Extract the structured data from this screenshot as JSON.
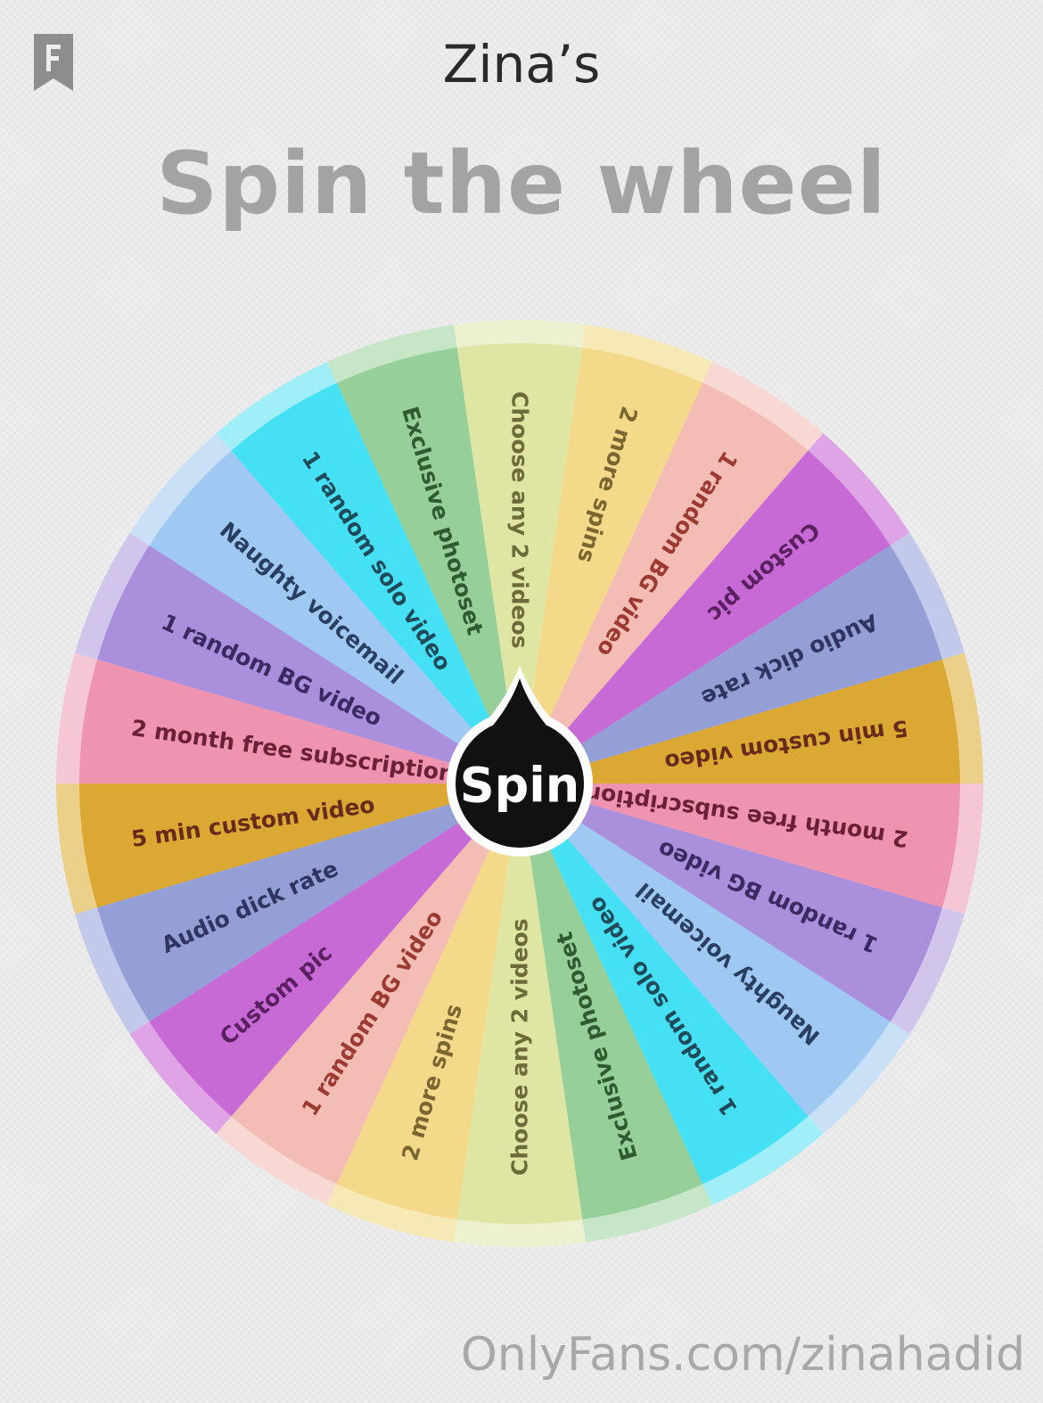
{
  "header": {
    "title": "Zina’s"
  },
  "main": {
    "heading": "Spin the wheel"
  },
  "wheel": {
    "spin_label": "Spin",
    "segments": [
      {
        "label": "Choose any 2 videos",
        "color": "#dfe6a4",
        "rim": "#eef1cf",
        "text": "#6e6a3a"
      },
      {
        "label": "2 more spins",
        "color": "#f5d98a",
        "rim": "#f7e9b6",
        "text": "#7a6630"
      },
      {
        "label": "1 random BG video",
        "color": "#f3bdb6",
        "rim": "#f7d8d3",
        "text": "#9a3a30"
      },
      {
        "label": "Custom pic",
        "color": "#c86ad6",
        "rim": "#dea4e6",
        "text": "#5a2060"
      },
      {
        "label": "Audio dick rate",
        "color": "#949fd6",
        "rim": "#c3c9ea",
        "text": "#2f3560"
      },
      {
        "label": "5 min custom video",
        "color": "#dca834",
        "rim": "#ecd08a",
        "text": "#6a2a1a"
      },
      {
        "label": "2 month free subscription",
        "color": "#ee94b0",
        "rim": "#f5c6d4",
        "text": "#6a2035"
      },
      {
        "label": "1 random BG video",
        "color": "#a98fdc",
        "rim": "#d1c5ec",
        "text": "#3a2a60"
      },
      {
        "label": "Naughty voicemail",
        "color": "#9fc8f2",
        "rim": "#c9e0f7",
        "text": "#2a3f60"
      },
      {
        "label": "1 random solo video",
        "color": "#46e0f4",
        "rim": "#a0eff8",
        "text": "#1f4a5a"
      },
      {
        "label": "Exclusive photoset",
        "color": "#96cf99",
        "rim": "#c6e6c7",
        "text": "#2f5a32"
      }
    ]
  },
  "footer": {
    "text": "OnlyFans.com/zinahadid"
  },
  "icons": {
    "bookmark": "bookmark-f-icon"
  }
}
